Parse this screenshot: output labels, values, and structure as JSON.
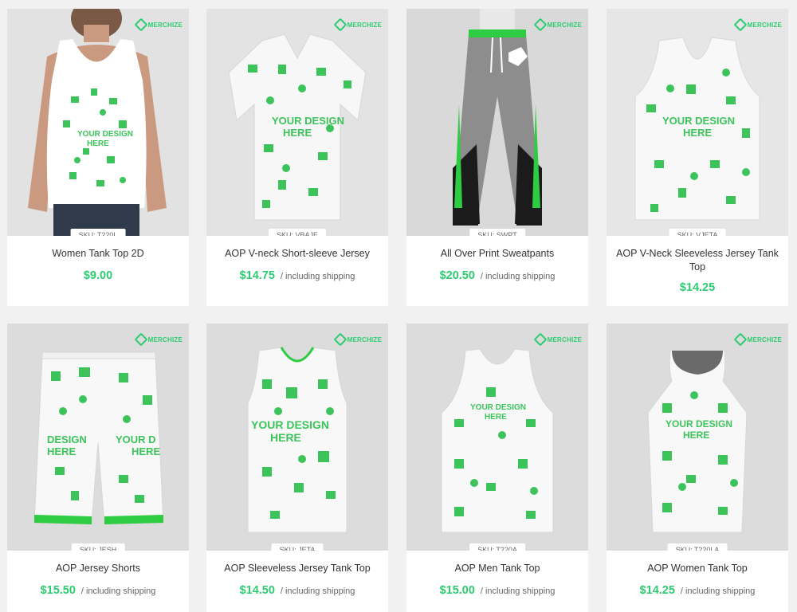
{
  "brand": "MERCHIZE",
  "colors": {
    "accent": "#2ecc71",
    "price": "#2ecc71",
    "card_bg": "#ffffff",
    "page_bg": "#f1f1f1"
  },
  "shipping_note": "/ including shipping",
  "products": [
    {
      "sku": "SKU: T220L",
      "title": "Women Tank Top 2D",
      "price": "$9.00",
      "shipping": "",
      "image_icon": "tank-top-model-photo"
    },
    {
      "sku": "SKU: VBAJE",
      "title": "AOP V-neck Short-sleeve Jersey",
      "price": "$14.75",
      "shipping": "/ including shipping",
      "image_icon": "vneck-jersey-photo"
    },
    {
      "sku": "SKU: SWPT",
      "title": "All Over Print Sweatpants",
      "price": "$20.50",
      "shipping": "/ including shipping",
      "image_icon": "sweatpants-photo"
    },
    {
      "sku": "SKU: VJETA",
      "title": "AOP V-Neck Sleeveless Jersey Tank Top",
      "price": "$14.25",
      "shipping": "",
      "image_icon": "sleeveless-jersey-photo"
    },
    {
      "sku": "SKU: JESH",
      "title": "AOP Jersey Shorts",
      "price": "$15.50",
      "shipping": "/ including shipping",
      "image_icon": "jersey-shorts-photo"
    },
    {
      "sku": "SKU: JETA",
      "title": "AOP Sleeveless Jersey Tank Top",
      "price": "$14.50",
      "shipping": "/ including shipping",
      "image_icon": "jersey-tank-photo"
    },
    {
      "sku": "SKU: T220A",
      "title": "AOP Men Tank Top",
      "price": "$15.00",
      "shipping": "/ including shipping",
      "image_icon": "men-tank-photo"
    },
    {
      "sku": "SKU: T220LA",
      "title": "AOP Women Tank Top",
      "price": "$14.25",
      "shipping": "/ including shipping",
      "image_icon": "women-tank-photo"
    }
  ]
}
